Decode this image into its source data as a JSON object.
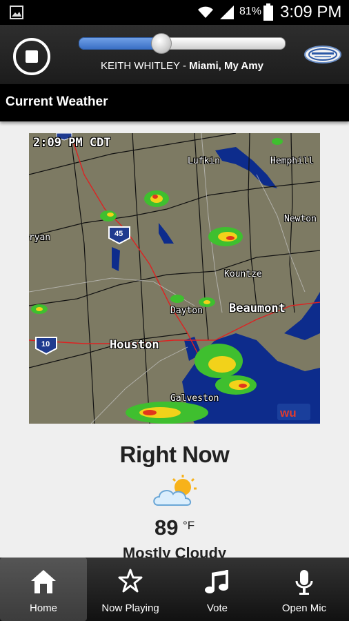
{
  "status_bar": {
    "battery_percent": "81%",
    "time": "3:09 PM"
  },
  "player": {
    "progress": 0.4,
    "artist": "KEITH WHITLEY",
    "separator": " - ",
    "song": "Miami, My Amy"
  },
  "section": {
    "title": "Current Weather"
  },
  "radar": {
    "timestamp": "2:09 PM CDT",
    "labels": {
      "lufkin": "Lufkin",
      "hemphill": "Hemphill",
      "newton": "Newton",
      "bryan": "Bryan",
      "kountze": "Kountze",
      "beaumont": "Beaumont",
      "dayton": "Dayton",
      "houston": "Houston",
      "galveston": "Galveston"
    },
    "shields": {
      "i45": "45",
      "i10": "10"
    }
  },
  "current": {
    "heading": "Right Now",
    "temperature": "89",
    "unit": "°F",
    "condition": "Mostly Cloudy"
  },
  "nav": {
    "home": "Home",
    "now_playing": "Now Playing",
    "vote": "Vote",
    "open_mic": "Open Mic"
  },
  "colors": {
    "seek_fill": "#4a7fd6",
    "radar_land": "#7d7a63",
    "water": "#0d2c8c"
  },
  "icons": [
    "gallery-icon",
    "wifi-icon",
    "signal-icon",
    "battery-icon",
    "stop-icon",
    "station-logo",
    "partly-cloudy-icon",
    "home-icon",
    "star-icon",
    "music-note-icon",
    "microphone-icon"
  ]
}
